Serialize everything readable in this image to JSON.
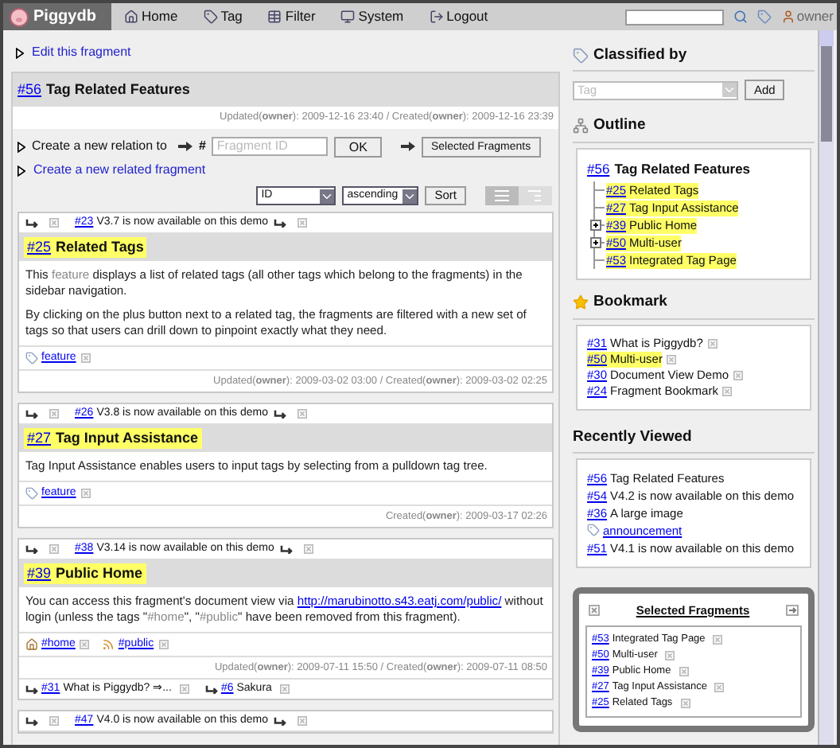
{
  "nav": {
    "logo": "Piggydb",
    "items": [
      {
        "kind": "home",
        "label": "Home"
      },
      {
        "kind": "tag",
        "label": "Tag"
      },
      {
        "kind": "filter",
        "label": "Filter"
      },
      {
        "kind": "system",
        "label": "System"
      },
      {
        "kind": "logout",
        "label": "Logout"
      }
    ],
    "user": "owner"
  },
  "edit_link": "Edit this fragment",
  "fragment": {
    "id": "#56",
    "title": "Tag Related Features",
    "timestamps": "Updated(**owner**): 2009-12-16 23:40 / Created(**owner**): 2009-12-16 23:39"
  },
  "relation": {
    "label": "Create a new relation to",
    "hash": "#",
    "placeholder": "Fragment ID",
    "ok": "OK",
    "selected_button": "Selected Fragments",
    "new_link": "Create a new related fragment"
  },
  "sort": {
    "field": "ID",
    "order": "ascending",
    "button": "Sort"
  },
  "children": [
    {
      "parent": {
        "id": "#23",
        "title": "V3.7 is now available on this demo"
      },
      "id": "#25",
      "title": "Related Tags",
      "body": [
        [
          {
            "text": "This "
          },
          {
            "text": "feature",
            "kind": "term"
          },
          {
            "text": " displays a list of related tags (all other tags which belong to the fragments) in the sidebar navigation."
          }
        ],
        [
          {
            "text": "By clicking on the plus button next to a related tag, the fragments are filtered with a new set of tags so that users can drill down to pinpoint exactly what they need."
          }
        ]
      ],
      "tags": [
        {
          "kind": "tag",
          "label": "feature"
        }
      ],
      "timestamps": "Updated(**owner**): 2009-03-02 03:00 / Created(**owner**): 2009-03-02 02:25"
    },
    {
      "parent": {
        "id": "#26",
        "title": "V3.8 is now available on this demo"
      },
      "id": "#27",
      "title": "Tag Input Assistance",
      "body": [
        [
          {
            "text": "Tag Input Assistance enables users to input tags by selecting from a pulldown tag tree."
          }
        ]
      ],
      "tags": [
        {
          "kind": "tag",
          "label": "feature"
        }
      ],
      "timestamps": "Created(**owner**): 2009-03-17 02:26"
    },
    {
      "parent": {
        "id": "#38",
        "title": "V3.14 is now available on this demo"
      },
      "id": "#39",
      "title": "Public Home",
      "body": [
        [
          {
            "text": "You can access this fragment's document view via "
          },
          {
            "text": "http://marubinotto.s43.eatj.com/public/",
            "kind": "link"
          },
          {
            "text": " without login (unless the tags \""
          },
          {
            "text": "#home",
            "kind": "term"
          },
          {
            "text": "\", \""
          },
          {
            "text": "#public",
            "kind": "term"
          },
          {
            "text": "\" have been removed from this fragment)."
          }
        ]
      ],
      "tags": [
        {
          "kind": "home",
          "label": "#home"
        },
        {
          "kind": "public",
          "label": "#public"
        }
      ],
      "timestamps": "Updated(**owner**): 2009-07-11 15:50 / Created(**owner**): 2009-07-11 08:50",
      "related": [
        {
          "id": "#31",
          "title": "What is Piggydb? ⇒..."
        },
        {
          "id": "#6",
          "title": "Sakura"
        }
      ]
    },
    {
      "parent": {
        "id": "#47",
        "title": "V4.0 is now available on this demo"
      }
    }
  ],
  "classified": {
    "title": "Classified by",
    "placeholder": "Tag",
    "button": "Add"
  },
  "outline": {
    "title": "Outline",
    "root": {
      "id": "#56",
      "title": "Tag Related Features"
    },
    "children": [
      {
        "id": "#25",
        "title": "Related Tags",
        "expandable": false
      },
      {
        "id": "#27",
        "title": "Tag Input Assistance",
        "expandable": false
      },
      {
        "id": "#39",
        "title": "Public Home",
        "expandable": true
      },
      {
        "id": "#50",
        "title": "Multi-user",
        "expandable": true
      },
      {
        "id": "#53",
        "title": "Integrated Tag Page",
        "expandable": false
      }
    ]
  },
  "bookmark": {
    "title": "Bookmark",
    "items": [
      {
        "id": "#31",
        "title": "What is Piggydb?",
        "highlighted": false
      },
      {
        "id": "#50",
        "title": "Multi-user",
        "highlighted": true
      },
      {
        "id": "#30",
        "title": "Document View Demo",
        "highlighted": false
      },
      {
        "id": "#24",
        "title": "Fragment Bookmark",
        "highlighted": false
      }
    ]
  },
  "recent": {
    "title": "Recently Viewed",
    "items": [
      {
        "kind": "fragment",
        "id": "#56",
        "title": "Tag Related Features"
      },
      {
        "kind": "fragment",
        "id": "#54",
        "title": "V4.2 is now available on this demo"
      },
      {
        "kind": "fragment",
        "id": "#36",
        "title": "A large image"
      },
      {
        "kind": "tag",
        "title": "announcement"
      },
      {
        "kind": "fragment",
        "id": "#51",
        "title": "V4.1 is now available on this demo"
      }
    ]
  },
  "selected": {
    "title": "Selected Fragments",
    "items": [
      {
        "id": "#53",
        "title": "Integrated Tag Page"
      },
      {
        "id": "#50",
        "title": "Multi-user"
      },
      {
        "id": "#39",
        "title": "Public Home"
      },
      {
        "id": "#27",
        "title": "Tag Input Assistance"
      },
      {
        "id": "#25",
        "title": "Related Tags"
      }
    ]
  }
}
